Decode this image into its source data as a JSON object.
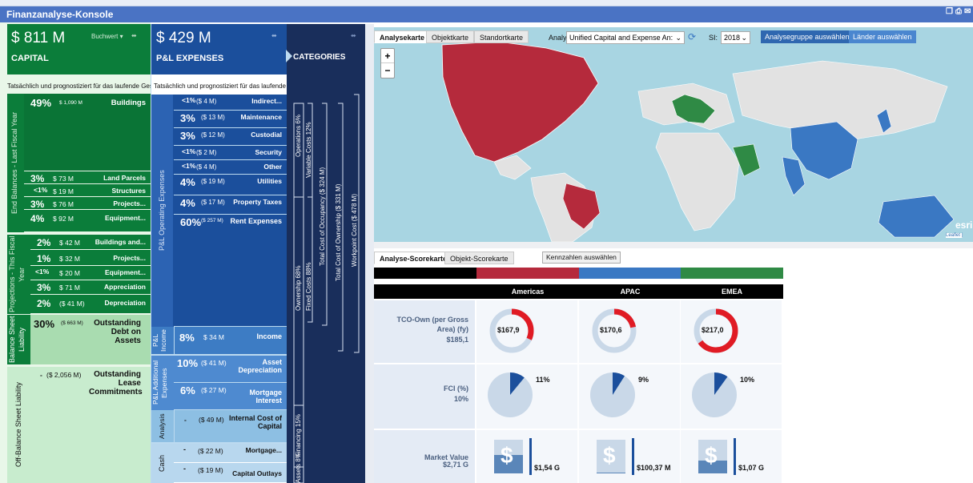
{
  "window": {
    "title": "Finanzanalyse-Konsole"
  },
  "capital": {
    "amount": "$ 811 M",
    "title": "CAPITAL",
    "dropdown": "Buchwert",
    "note": "Tatsächlich und prognostiziert für das laufende Geschäftsjahr",
    "section_end": "End Balances - Last Fiscal Year",
    "section_proj": "Projections - This Fiscal Year",
    "section_bal": "Balance Sheet Liability",
    "section_off": "Off-Balance Sheet Liability",
    "rows": [
      {
        "pct": "49%",
        "amt": "$ 1,090 M",
        "label": "Buildings"
      },
      {
        "pct": "3%",
        "amt": "$ 73 M",
        "label": "Land Parcels"
      },
      {
        "pct": "<1%",
        "amt": "$ 19 M",
        "label": "Structures"
      },
      {
        "pct": "3%",
        "amt": "$ 76 M",
        "label": "Projects..."
      },
      {
        "pct": "4%",
        "amt": "$ 92 M",
        "label": "Equipment..."
      },
      {
        "pct": "2%",
        "amt": "$ 42 M",
        "label": "Buildings and..."
      },
      {
        "pct": "1%",
        "amt": "$ 32 M",
        "label": "Projects..."
      },
      {
        "pct": "<1%",
        "amt": "$ 20 M",
        "label": "Equipment..."
      },
      {
        "pct": "3%",
        "amt": "$ 71 M",
        "label": "Appreciation"
      },
      {
        "pct": "2%",
        "amt": "($ 41 M)",
        "label": "Depreciation"
      },
      {
        "pct": "30%",
        "amt": "($ 663 M)",
        "label": "Outstanding Debt on Assets"
      },
      {
        "pct": "-",
        "amt": "($ 2,056 M)",
        "label": "Outstanding Lease Commitments"
      }
    ]
  },
  "pl": {
    "amount": "$ 429 M",
    "title": "P&L EXPENSES",
    "note": "Tatsächlich und prognostiziert für das laufende Geschäftsjahr",
    "section_op": "P&L Operating Expenses",
    "section_inc": "P&L Income",
    "section_add": "P&L Additional Expenses",
    "section_an": "Analysis",
    "section_cash": "Cash",
    "rows": [
      {
        "pct": "<1%",
        "amt": "($ 4 M)",
        "label": "Indirect..."
      },
      {
        "pct": "3%",
        "amt": "($ 13 M)",
        "label": "Maintenance"
      },
      {
        "pct": "3%",
        "amt": "($ 12 M)",
        "label": "Custodial"
      },
      {
        "pct": "<1%",
        "amt": "($ 2 M)",
        "label": "Security"
      },
      {
        "pct": "<1%",
        "amt": "($ 4 M)",
        "label": "Other"
      },
      {
        "pct": "4%",
        "amt": "($ 19 M)",
        "label": "Utilities"
      },
      {
        "pct": "4%",
        "amt": "($ 17 M)",
        "label": "Property Taxes"
      },
      {
        "pct": "60%",
        "amt": "($ 257 M)",
        "label": "Rent Expenses"
      },
      {
        "pct": "8%",
        "amt": "$ 34 M",
        "label": "Income"
      },
      {
        "pct": "10%",
        "amt": "($ 41 M)",
        "label": "Asset Depreciation"
      },
      {
        "pct": "6%",
        "amt": "($ 27 M)",
        "label": "Mortgage Interest"
      },
      {
        "pct": "-",
        "amt": "($ 49 M)",
        "label": "Internal Cost of Capital"
      },
      {
        "pct": "-",
        "amt": "($ 22 M)",
        "label": "Mortgage..."
      },
      {
        "pct": "-",
        "amt": "($ 19 M)",
        "label": "Capital Outlays"
      }
    ]
  },
  "categories": {
    "title": "CATEGORIES",
    "labels": [
      "Operations 6%",
      "Variable Costs 12%",
      "Total Cost of Occupancy ($ 324 M)",
      "Total Cost of Ownership ($ 331 M)",
      "Workpoint Cost ($ 478 M)",
      "Ownership 68%",
      "Fixed Costs 88%",
      "Financing 15%",
      "Assets 8%"
    ]
  },
  "map": {
    "tabs": [
      "Analysekarte",
      "Objektkarte",
      "Standortkarte"
    ],
    "analyse_label": "Analyse:",
    "analyse_value": "Unified Capital and Expense An:",
    "si_label": "SI:",
    "si_value": "2018",
    "btn_group": "Analysegruppe auswählen",
    "btn_countries": "Länder auswählen",
    "zoom_in": "+",
    "zoom_out": "−",
    "esri": "esri",
    "leaflet": "Leaflet |",
    "colors": {
      "red": "#b52a3c",
      "blue": "#3a78c3",
      "green": "#2f8a45",
      "land": "#e2e2e2",
      "sea": "#a8d5e2"
    }
  },
  "scorecard": {
    "tabs": [
      "Analyse-Scorekarte",
      "Objekt-Scorekarte"
    ],
    "btn": "Kennzahlen auswählen",
    "regions": [
      "Americas",
      "APAC",
      "EMEA"
    ],
    "region_colors": [
      "#b52a3c",
      "#3a78c3",
      "#2f8a45"
    ],
    "metrics": [
      {
        "name": "TCO-Own (per Gross Area) (fy)",
        "total": "$185,1",
        "values": [
          "$167,9",
          "$170,6",
          "$217,0"
        ],
        "fills": [
          0.32,
          0.22,
          0.65
        ]
      },
      {
        "name": "FCI (%)",
        "total": "10%",
        "values": [
          "11%",
          "9%",
          "10%"
        ],
        "fills": [
          0.11,
          0.09,
          0.1
        ]
      },
      {
        "name": "Market Value",
        "total": "$2,71 G",
        "values": [
          "$1,54 G",
          "$100,37 M",
          "$1,07 G"
        ],
        "fills": [
          0.55,
          0.02,
          0.38
        ]
      }
    ]
  }
}
